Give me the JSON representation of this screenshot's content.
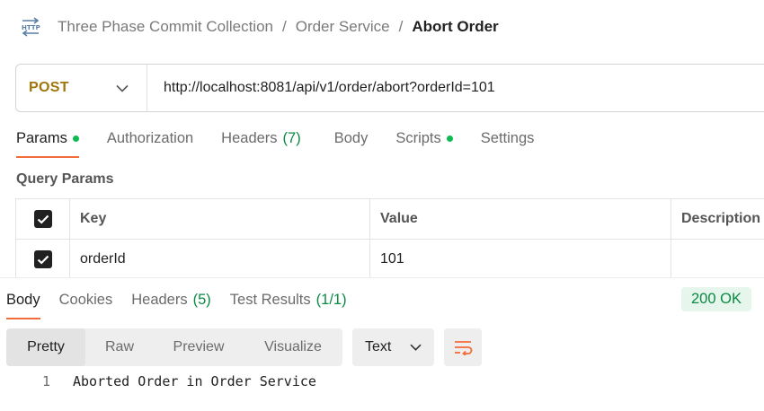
{
  "breadcrumb": {
    "icon": "http-icon",
    "items": [
      "Three Phase Commit Collection",
      "Order Service"
    ],
    "current": "Abort Order",
    "separator": "/"
  },
  "request": {
    "method": "POST",
    "url": "http://localhost:8081/api/v1/order/abort?orderId=101"
  },
  "request_tabs": {
    "params": "Params",
    "authorization": "Authorization",
    "headers": "Headers",
    "headers_count": "(7)",
    "body": "Body",
    "scripts": "Scripts",
    "settings": "Settings",
    "active": "Params"
  },
  "query_params": {
    "title": "Query Params",
    "columns": [
      "Key",
      "Value",
      "Description"
    ],
    "rows": [
      {
        "key": "orderId",
        "value": "101",
        "description": "",
        "checked": true
      }
    ]
  },
  "response_tabs": {
    "body": "Body",
    "cookies": "Cookies",
    "headers": "Headers",
    "headers_count": "(5)",
    "test_results": "Test Results",
    "test_results_count": "(1/1)",
    "active": "Body"
  },
  "status": {
    "text": "200 OK",
    "color": "#0a8a43"
  },
  "format_tabs": [
    "Pretty",
    "Raw",
    "Preview",
    "Visualize"
  ],
  "format_active": "Pretty",
  "type_select": "Text",
  "response_body": [
    {
      "line": "1",
      "text": "Aborted Order in Order Service"
    }
  ],
  "colors": {
    "accent": "#f26b3a",
    "method": "#a0760a",
    "success": "#0cbb52"
  }
}
